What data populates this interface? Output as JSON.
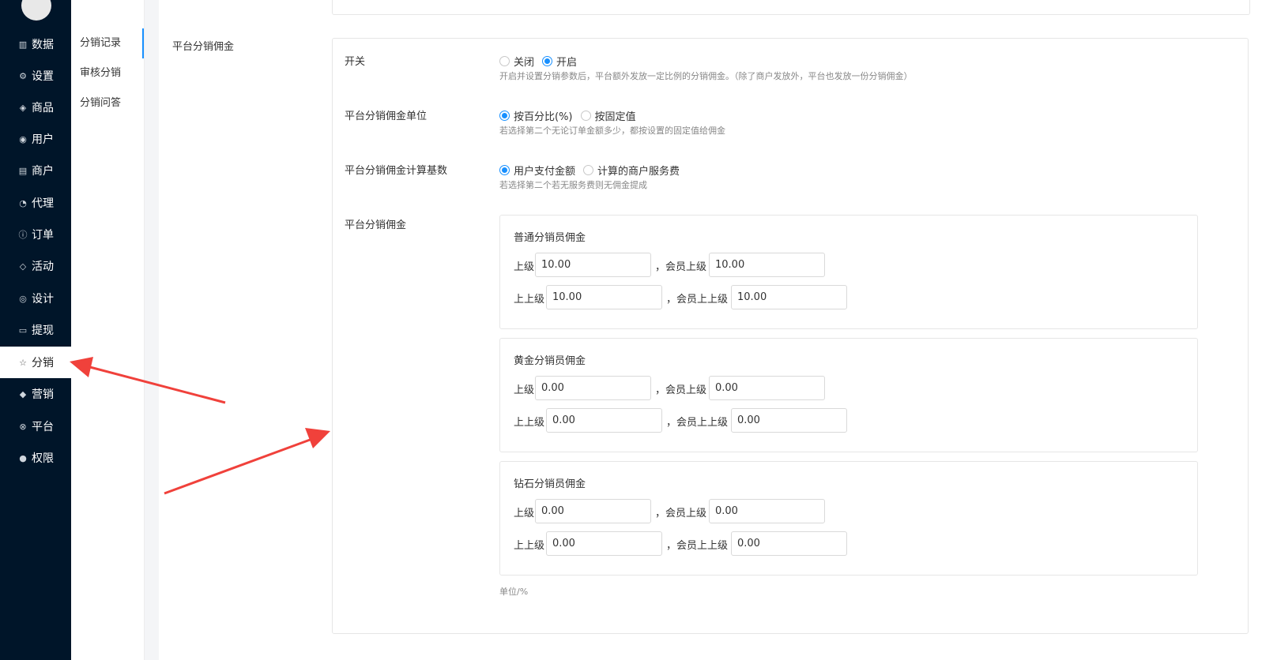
{
  "sidebar": {
    "items": [
      {
        "label": "数据",
        "icon": "bar-chart-icon",
        "glyph": "▥"
      },
      {
        "label": "设置",
        "icon": "gear-icon",
        "glyph": "⚙"
      },
      {
        "label": "商品",
        "icon": "cube-icon",
        "glyph": "◈"
      },
      {
        "label": "用户",
        "icon": "user-icon",
        "glyph": "◉"
      },
      {
        "label": "商户",
        "icon": "document-icon",
        "glyph": "▤"
      },
      {
        "label": "代理",
        "icon": "clock-icon",
        "glyph": "◔"
      },
      {
        "label": "订单",
        "icon": "info-icon",
        "glyph": "ⓘ"
      },
      {
        "label": "活动",
        "icon": "tag-icon",
        "glyph": "◇"
      },
      {
        "label": "设计",
        "icon": "palette-icon",
        "glyph": "◎"
      },
      {
        "label": "提现",
        "icon": "card-icon",
        "glyph": "▭"
      },
      {
        "label": "分销",
        "icon": "star-icon",
        "glyph": "☆"
      },
      {
        "label": "营销",
        "icon": "layers-icon",
        "glyph": "◆"
      },
      {
        "label": "平台",
        "icon": "globe-icon",
        "glyph": "⊗"
      },
      {
        "label": "权限",
        "icon": "shield-icon",
        "glyph": "●"
      }
    ]
  },
  "subnav": {
    "items": [
      "分销记录",
      "审核分销",
      "分销问答"
    ]
  },
  "section": {
    "title": "平台分销佣金"
  },
  "switch": {
    "label": "开关",
    "off": "关闭",
    "on": "开启",
    "help": "开启并设置分销参数后，平台额外发放一定比例的分销佣金。（除了商户发放外，平台也发放一份分销佣金）"
  },
  "unit_setting": {
    "label": "平台分销佣金单位",
    "opt1": "按百分比(%)",
    "opt2": "按固定值",
    "help": "若选择第二个无论订单金额多少，都按设置的固定值给佣金"
  },
  "base_setting": {
    "label": "平台分销佣金计算基数",
    "opt1": "用户支付金额",
    "opt2": "计算的商户服务费",
    "help": "若选择第二个若无服务费则无佣金提成"
  },
  "commission": {
    "label": "平台分销佣金",
    "field_labels": {
      "level1": "上级",
      "level2": "上上级",
      "member1": "，会员上级",
      "member2": "，会员上上级"
    },
    "tiers": [
      {
        "title": "普通分销员佣金",
        "level1": "10.00",
        "member1": "10.00",
        "level2": "10.00",
        "member2": "10.00"
      },
      {
        "title": "黄金分销员佣金",
        "level1": "0.00",
        "member1": "0.00",
        "level2": "0.00",
        "member2": "0.00"
      },
      {
        "title": "钻石分销员佣金",
        "level1": "0.00",
        "member1": "0.00",
        "level2": "0.00",
        "member2": "0.00"
      }
    ],
    "unit_note": "单位/%"
  },
  "colors": {
    "sidebar_bg": "#001529",
    "accent": "#1890ff",
    "arrow": "#f0413b"
  }
}
